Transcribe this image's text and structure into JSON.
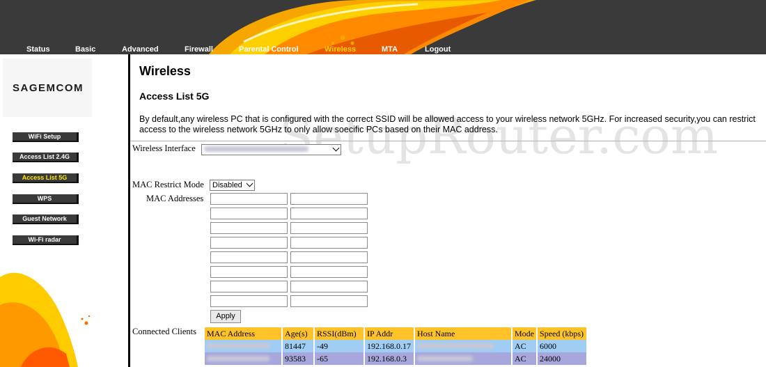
{
  "nav": {
    "items": [
      {
        "label": "Status"
      },
      {
        "label": "Basic"
      },
      {
        "label": "Advanced"
      },
      {
        "label": "Firewall"
      },
      {
        "label": "Parental Control"
      },
      {
        "label": "Wireless"
      },
      {
        "label": "MTA"
      },
      {
        "label": "Logout"
      }
    ],
    "active": "Wireless"
  },
  "sidebar": {
    "logo": "SAGEMCOM",
    "items": [
      {
        "label": "WiFi Setup"
      },
      {
        "label": "Access List 2.4G"
      },
      {
        "label": "Access List 5G"
      },
      {
        "label": "WPS"
      },
      {
        "label": "Guest Network"
      },
      {
        "label": "Wi-Fi radar"
      }
    ],
    "active": "Access List 5G"
  },
  "watermark": "SetupRouter.com",
  "page": {
    "title": "Wireless",
    "subtitle": "Access List 5G",
    "description": "By default,any wireless PC that is configured with the correct SSID will be allowed access to your wireless network 5GHz. For increased security,you can restrict access to the wireless network 5GHz to only allow soecific PCs based on their MAC address."
  },
  "form": {
    "wireless_interface_label": "Wireless Interface",
    "wireless_interface_value": "",
    "mac_restrict_label": "MAC Restrict Mode",
    "mac_restrict_value": "Disabled",
    "mac_addresses_label": "MAC Addresses",
    "apply_label": "Apply"
  },
  "clients": {
    "label": "Connected Clients",
    "headers": [
      "MAC Address",
      "Age(s)",
      "RSSI(dBm)",
      "IP Addr",
      "Host Name",
      "Mode",
      "Speed (kbps)"
    ],
    "rows": [
      {
        "mac": "",
        "age": "81447",
        "rssi": "-49",
        "ip": "192.168.0.17",
        "host": "",
        "mode": "AC",
        "speed": "6000"
      },
      {
        "mac": "",
        "age": "93583",
        "rssi": "-65",
        "ip": "192.168.0.3",
        "host": "",
        "mode": "AC",
        "speed": "24000"
      }
    ]
  },
  "colors": {
    "header_bg": "#3a3a3a",
    "nav_active": "#ffd200",
    "table_header": "#ffc329",
    "row1": "#9fcdf3",
    "row2": "#a8a7dc"
  }
}
